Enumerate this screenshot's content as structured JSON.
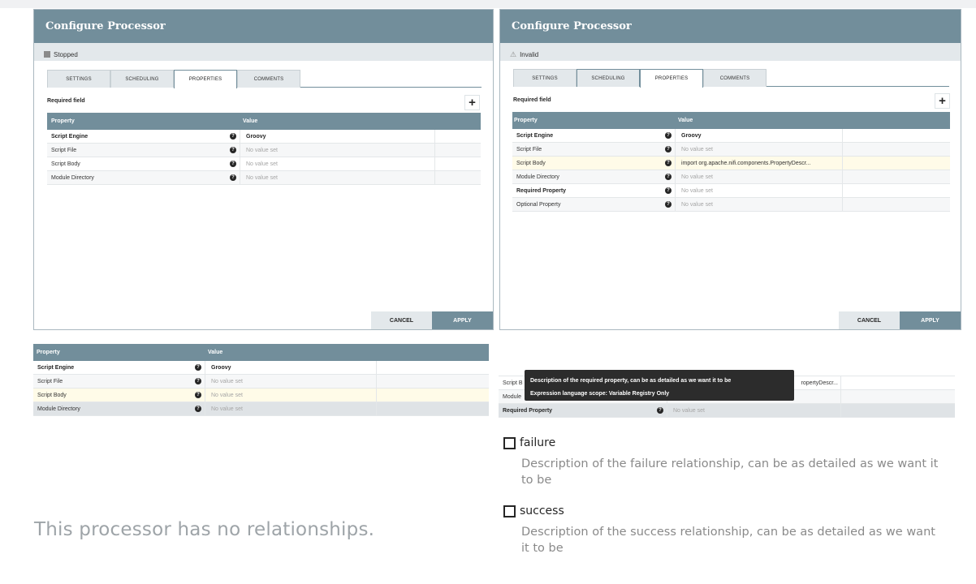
{
  "left_dialog": {
    "title": "Configure Processor",
    "status": "Stopped",
    "tabs": [
      "SETTINGS",
      "SCHEDULING",
      "PROPERTIES",
      "COMMENTS"
    ],
    "active_tab": "PROPERTIES",
    "required_label": "Required field",
    "add_button": "+",
    "columns": [
      "Property",
      "Value"
    ],
    "rows": [
      {
        "property": "Script Engine",
        "value": "Groovy"
      },
      {
        "property": "Script File",
        "value": "No value set"
      },
      {
        "property": "Script Body",
        "value": "No value set"
      },
      {
        "property": "Module Directory",
        "value": "No value set"
      }
    ],
    "cancel": "CANCEL",
    "apply": "APPLY"
  },
  "right_dialog": {
    "title": "Configure Processor",
    "status": "Invalid",
    "tabs": [
      "SETTINGS",
      "SCHEDULING",
      "PROPERTIES",
      "COMMENTS"
    ],
    "active_tab": "PROPERTIES",
    "required_label": "Required field",
    "add_button": "+",
    "columns": [
      "Property",
      "Value"
    ],
    "rows": [
      {
        "property": "Script Engine",
        "value": "Groovy"
      },
      {
        "property": "Script File",
        "value": "No value set"
      },
      {
        "property": "Script Body",
        "value": "import org.apache.nifi.components.PropertyDescr..."
      },
      {
        "property": "Module Directory",
        "value": "No value set"
      },
      {
        "property": "Required Property",
        "value": "No value set"
      },
      {
        "property": "Optional Property",
        "value": "No value set"
      }
    ],
    "cancel": "CANCEL",
    "apply": "APPLY"
  },
  "bottom_left_table": {
    "columns": [
      "Property",
      "Value"
    ],
    "rows": [
      {
        "property": "Script Engine",
        "value": "Groovy"
      },
      {
        "property": "Script File",
        "value": "No value set"
      },
      {
        "property": "Script Body",
        "value": "No value set"
      },
      {
        "property": "Module Directory",
        "value": "No value set"
      }
    ]
  },
  "bottom_right_table": {
    "rows": [
      {
        "property": "Script B",
        "value": "ropertyDescr..."
      },
      {
        "property": "Module",
        "value": ""
      },
      {
        "property": "Required Property",
        "value": "No value set"
      }
    ]
  },
  "tooltip": {
    "line1": "Description of the required property, can be as detailed as we want it to be",
    "line2": "Expression language scope: Variable Registry Only"
  },
  "relationships": [
    {
      "name": "failure",
      "description": "Description of the failure relationship, can be as detailed as we want it to be",
      "checked": false
    },
    {
      "name": "success",
      "description": "Description of the success relationship, can be as detailed as we want it to be",
      "checked": false
    }
  ],
  "no_relationships": "This processor has no relationships."
}
